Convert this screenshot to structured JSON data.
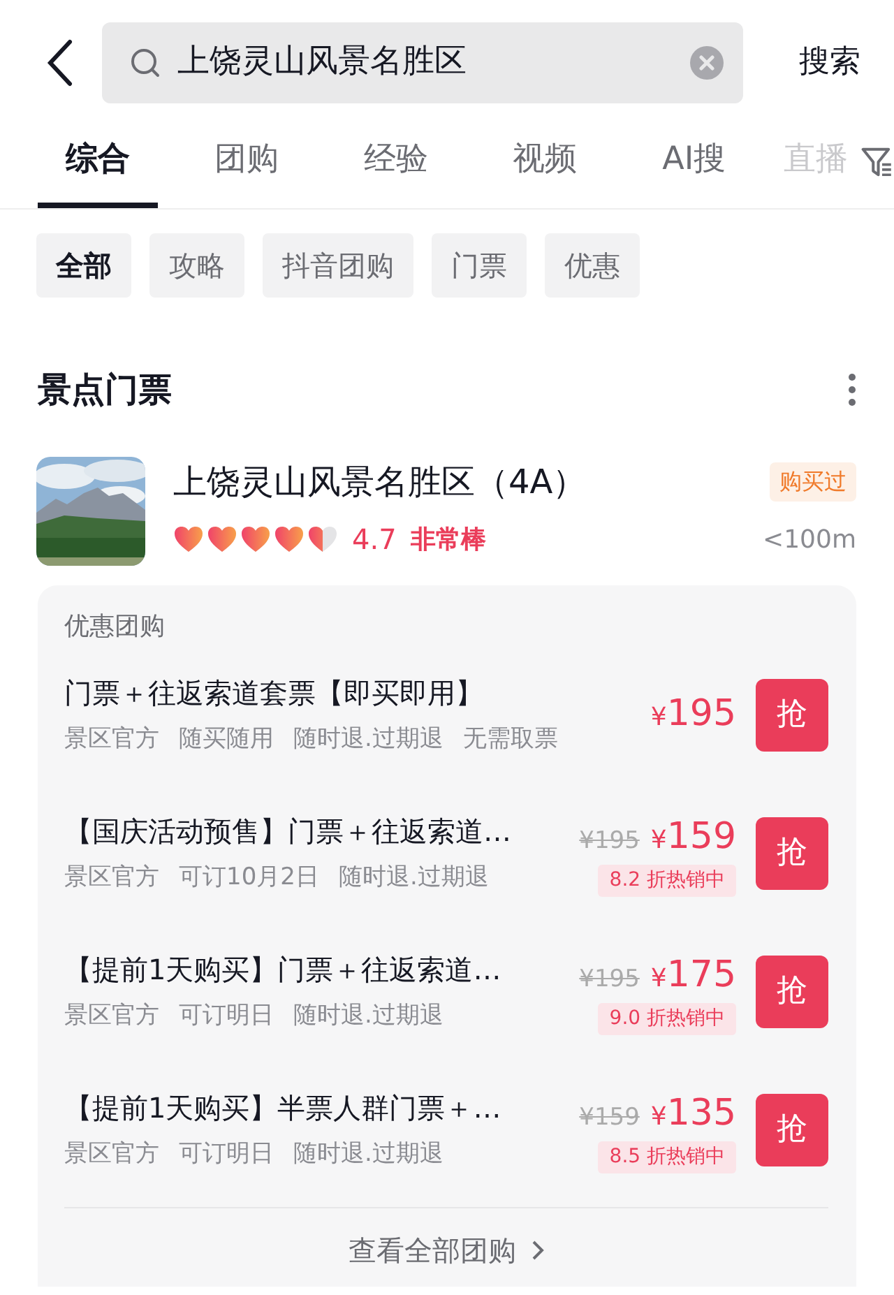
{
  "search": {
    "query": "上饶灵山风景名胜区",
    "button": "搜索"
  },
  "tabs": [
    {
      "label": "综合",
      "selected": true,
      "faded": false
    },
    {
      "label": "团购",
      "selected": false,
      "faded": false
    },
    {
      "label": "经验",
      "selected": false,
      "faded": false
    },
    {
      "label": "视频",
      "selected": false,
      "faded": false
    },
    {
      "label": "AI搜",
      "selected": false,
      "faded": false
    },
    {
      "label": "直播",
      "selected": false,
      "faded": true
    }
  ],
  "chips": [
    {
      "label": "全部",
      "selected": true
    },
    {
      "label": "攻略",
      "selected": false
    },
    {
      "label": "抖音团购",
      "selected": false
    },
    {
      "label": "门票",
      "selected": false
    },
    {
      "label": "优惠",
      "selected": false
    }
  ],
  "section": {
    "title": "景点门票"
  },
  "attraction": {
    "name": "上饶灵山风景名胜区（4A）",
    "badge": "购买过",
    "stars": 4.5,
    "rating": "4.7",
    "rating_text": "非常棒",
    "distance": "<100m"
  },
  "deals": {
    "title": "优惠团购",
    "items": [
      {
        "title": "门票＋往返索道套票【即买即用】",
        "tags": [
          "景区官方",
          "随买随用",
          "随时退.过期退",
          "无需取票"
        ],
        "currency": "¥",
        "price": "195",
        "button": "抢"
      },
      {
        "title": "【国庆活动预售】门票＋往返索道…",
        "tags": [
          "景区官方",
          "可订10月2日",
          "随时退.过期退"
        ],
        "original_price": "¥195",
        "currency": "¥",
        "price": "159",
        "discount": "8.2 折热销中",
        "button": "抢"
      },
      {
        "title": "【提前1天购买】门票＋往返索道…",
        "tags": [
          "景区官方",
          "可订明日",
          "随时退.过期退"
        ],
        "original_price": "¥195",
        "currency": "¥",
        "price": "175",
        "discount": "9.0 折热销中",
        "button": "抢"
      },
      {
        "title": "【提前1天购买】半票人群门票＋…",
        "tags": [
          "景区官方",
          "可订明日",
          "随时退.过期退"
        ],
        "original_price": "¥159",
        "currency": "¥",
        "price": "135",
        "discount": "8.5 折热销中",
        "button": "抢"
      }
    ],
    "more": "查看全部团购"
  }
}
